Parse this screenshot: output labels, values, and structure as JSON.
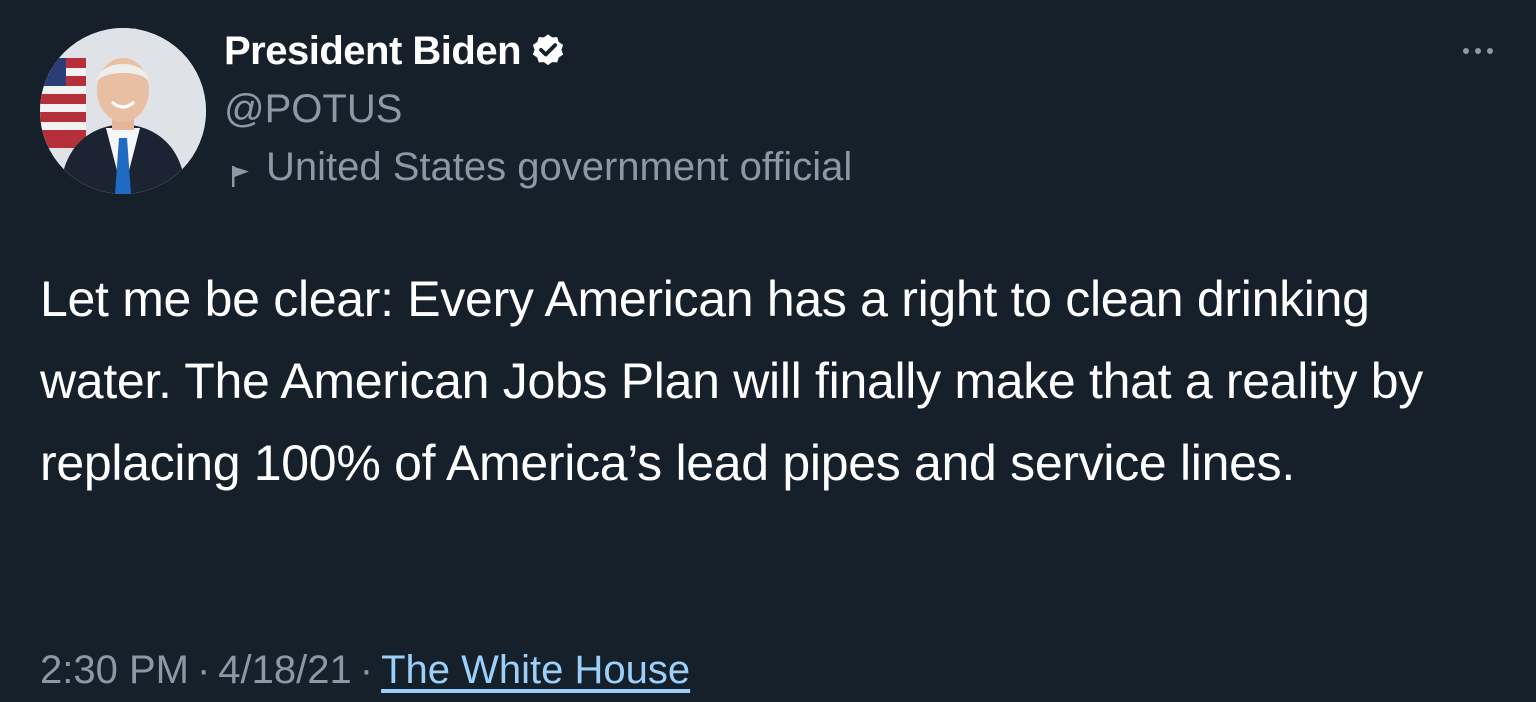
{
  "tweet": {
    "author": {
      "display_name": "President Biden",
      "handle": "@POTUS",
      "verified": true,
      "label": "United States government official",
      "avatar_icon": "profile-photo"
    },
    "text": "Let me be clear: Every American has a right to clean drinking water. The American Jobs Plan will finally make that a reality by replacing 100% of America’s lead pipes and service lines.",
    "time": "2:30 PM",
    "date": "4/18/21",
    "separator": "·",
    "source": "The White House",
    "more_icon": "more-options-icon"
  },
  "colors": {
    "background": "#15202b",
    "primary_text": "#ffffff",
    "secondary_text": "#8b98a5",
    "link": "#9ccff9"
  }
}
